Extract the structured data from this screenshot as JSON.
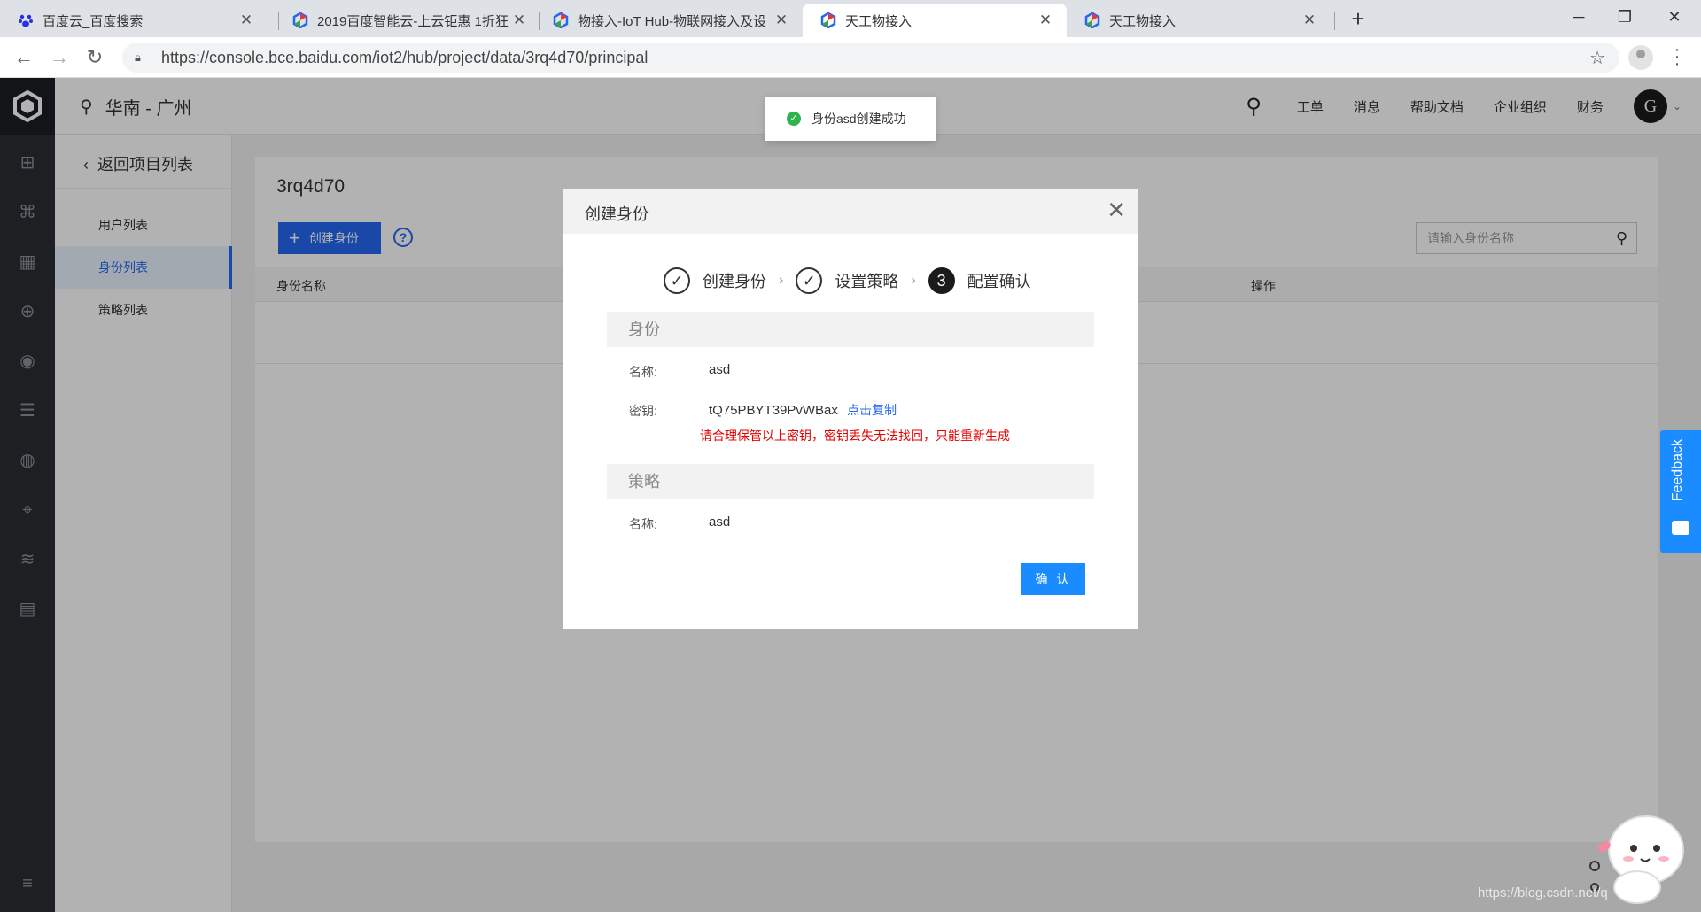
{
  "browser": {
    "tabs": [
      {
        "title": "百度云_百度搜索",
        "active": false
      },
      {
        "title": "2019百度智能云-上云钜惠 1折狂",
        "active": false
      },
      {
        "title": "物接入-IoT Hub-物联网接入及设",
        "active": false
      },
      {
        "title": "天工物接入",
        "active": true
      },
      {
        "title": "天工物接入",
        "active": false
      }
    ],
    "url": "https://console.bce.baidu.com/iot2/hub/project/data/3rq4d70/principal"
  },
  "topnav": {
    "region": "华南 - 广州",
    "links": [
      "工单",
      "消息",
      "帮助文档",
      "企业组织",
      "财务"
    ],
    "avatar_letter": "G"
  },
  "subnav": {
    "back": "返回项目列表",
    "items": [
      "用户列表",
      "身份列表",
      "策略列表"
    ],
    "active_index": 1
  },
  "content": {
    "project_name": "3rq4d70",
    "create_button": "创建身份",
    "search_placeholder": "请输入身份名称",
    "columns": [
      "身份名称",
      "操作"
    ]
  },
  "toast": {
    "text": "身份asd创建成功"
  },
  "modal": {
    "title": "创建身份",
    "steps": [
      {
        "label": "创建身份",
        "status": "done"
      },
      {
        "label": "设置策略",
        "status": "done"
      },
      {
        "label": "配置确认",
        "status": "current",
        "number": "3"
      }
    ],
    "identity_section": "身份",
    "identity_name_label": "名称:",
    "identity_name_value": "asd",
    "secret_label": "密钥:",
    "secret_value": "tQ75PBYT39PvWBax",
    "copy_link": "点击复制",
    "warning": "请合理保管以上密钥，密钥丢失无法找回，只能重新生成",
    "policy_section": "策略",
    "policy_name_label": "名称:",
    "policy_name_value": "asd",
    "confirm_button": "确 认"
  },
  "feedback": {
    "label": "Feedback"
  },
  "watermark": "https://blog.csdn.net/q",
  "colors": {
    "primary": "#2468f2",
    "confirm": "#1a8cff",
    "warning": "#e10000",
    "success": "#2fb34d"
  }
}
